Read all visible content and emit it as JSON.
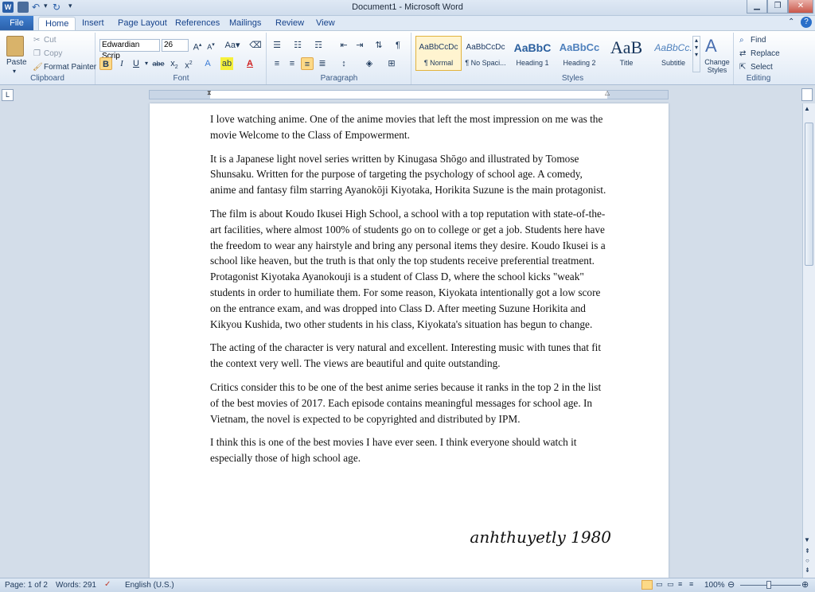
{
  "window": {
    "title": "Document1 - Microsoft Word"
  },
  "tabs": [
    {
      "label": "File"
    },
    {
      "label": "Home"
    },
    {
      "label": "Insert"
    },
    {
      "label": "Page Layout"
    },
    {
      "label": "References"
    },
    {
      "label": "Mailings"
    },
    {
      "label": "Review"
    },
    {
      "label": "View"
    }
  ],
  "clipboard": {
    "paste": "Paste",
    "cut": "Cut",
    "copy": "Copy",
    "format_painter": "Format Painter",
    "label": "Clipboard"
  },
  "font": {
    "name": "Edwardian Scrip",
    "size": "26",
    "label": "Font"
  },
  "paragraph": {
    "label": "Paragraph"
  },
  "styles": {
    "label": "Styles",
    "items": [
      {
        "preview": "AaBbCcDc",
        "name": "¶ Normal"
      },
      {
        "preview": "AaBbCcDc",
        "name": "¶ No Spaci..."
      },
      {
        "preview": "AaBbC",
        "name": "Heading 1"
      },
      {
        "preview": "AaBbCc",
        "name": "Heading 2"
      },
      {
        "preview": "AaB",
        "name": "Title"
      },
      {
        "preview": "AaBbCc.",
        "name": "Subtitle"
      }
    ],
    "change_styles": "Change Styles"
  },
  "editing": {
    "find": "Find",
    "replace": "Replace",
    "select": "Select",
    "label": "Editing"
  },
  "document": {
    "paragraphs": [
      "I love watching anime. One of the anime movies that left the most impression on me was the movie Welcome to the Class of Empowerment.",
      "It is a Japanese light novel series written by Kinugasa Shōgo and illustrated by Tomose Shunsaku. Written for the purpose of targeting the psychology of school age. A comedy, anime and fantasy film starring Ayanokōji Kiyotaka, Horikita Suzune is the main protagonist.",
      "The film is about Koudo Ikusei High School, a school with a top reputation with state-of-the-art facilities, where almost 100% of students go on to college or get a job. Students here have the freedom to wear any hairstyle and bring any personal items they desire. Koudo Ikusei is a school like heaven, but the truth is that only the top students receive preferential treatment. Protagonist Kiyotaka Ayanokouji is a student of Class D, where the school kicks \"weak\" students in order to humiliate them. For some reason, Kiyokata intentionally got a low score on the entrance exam, and was dropped into Class D. After meeting Suzune Horikita and Kikyou Kushida, two other students in his class, Kiyokata's situation has begun to change.",
      "The acting of the character is very natural and excellent. Interesting music with tunes that fit the context very well. The views are beautiful and quite outstanding.",
      "Critics consider this to be one of the best anime series because it ranks in the top 2 in the list of the best movies of 2017. Each episode contains meaningful messages for school age. In Vietnam, the novel is expected to be copyrighted and distributed by IPM.",
      "I think this is one of the best movies I have ever seen. I think everyone should watch it especially those of high school age."
    ],
    "signature": "anhthuyetly 1980"
  },
  "status": {
    "page": "Page: 1 of 2",
    "words": "Words: 291",
    "language": "English (U.S.)",
    "zoom": "100%"
  },
  "colors": {
    "accent": "#2a5fa8",
    "ribbon": "#dfe9f5",
    "spell_underline": "#d02020"
  }
}
